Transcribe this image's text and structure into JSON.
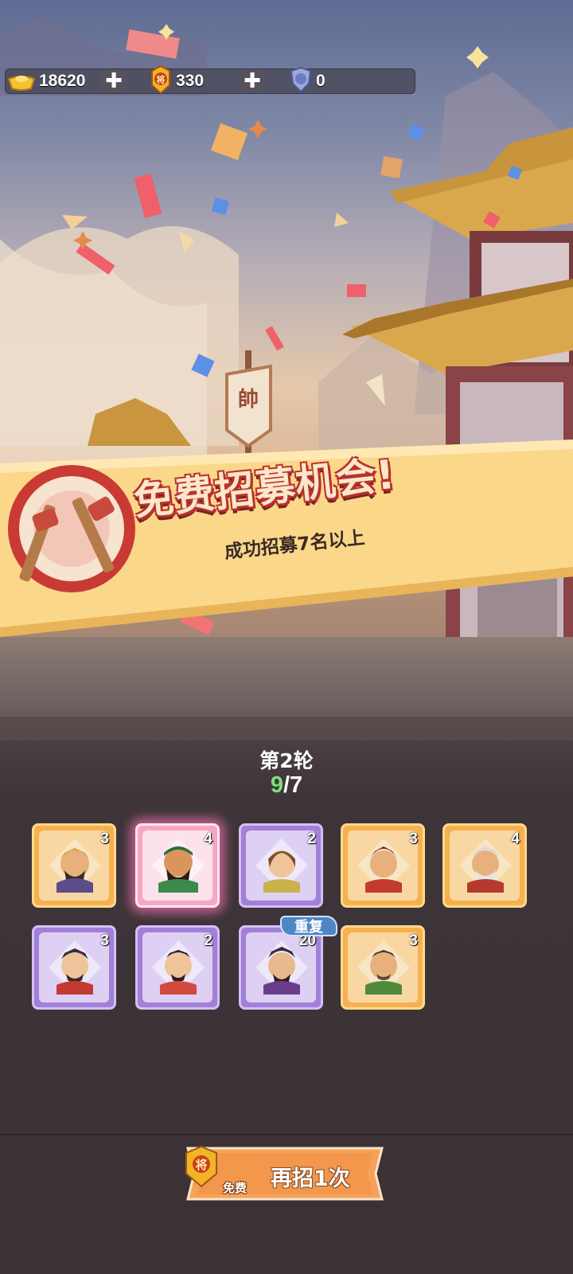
{
  "resources": {
    "gold": {
      "icon": "gold-ingot-icon",
      "value": "18620"
    },
    "token": {
      "icon": "general-token-icon",
      "value": "330"
    },
    "shield": {
      "icon": "shield-token-icon",
      "value": "0"
    },
    "plus_symbol": "✚"
  },
  "banner": {
    "title": "免费招募机会!",
    "subtitle": "成功招募7名以上",
    "flag_char": "帥"
  },
  "progress": {
    "round_label": "第2轮",
    "current": "9",
    "separator": "/",
    "target": "7"
  },
  "cards": [
    {
      "rarity": "gold",
      "count": "3"
    },
    {
      "rarity": "pink",
      "count": "4"
    },
    {
      "rarity": "purple",
      "count": "2"
    },
    {
      "rarity": "gold",
      "count": "3"
    },
    {
      "rarity": "gold",
      "count": "4"
    },
    {
      "rarity": "purple",
      "count": "3"
    },
    {
      "rarity": "purple",
      "count": "2"
    },
    {
      "rarity": "purple",
      "count": "20",
      "badge": "重复"
    },
    {
      "rarity": "gold",
      "count": "3"
    }
  ],
  "action_button": {
    "label": "再招1次",
    "cost_label": "免费",
    "badge_char": "将"
  },
  "colors": {
    "gold_card": "#f6b14e",
    "purple_card": "#a27fd8",
    "pink_card": "#f7a7c6",
    "count_current": "#7be07b",
    "banner_red": "#b8322e",
    "button_orange": "#f4a25a"
  }
}
